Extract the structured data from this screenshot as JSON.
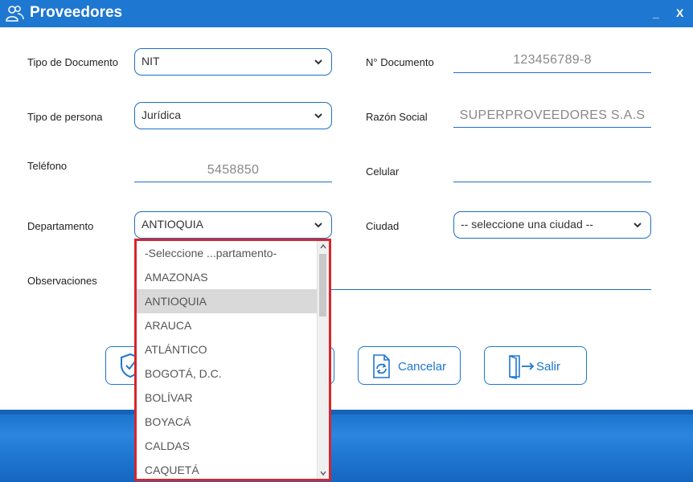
{
  "window": {
    "title": "Proveedores",
    "icon": "users-icon",
    "minimize_label": "_",
    "close_label": "X",
    "colors": {
      "titlebar": "#1e77d0",
      "accent": "#1e6fc0",
      "highlight": "#d7262c"
    }
  },
  "form": {
    "tipo_documento": {
      "label": "Tipo de Documento",
      "value": "NIT"
    },
    "numero_documento": {
      "label": "N° Documento",
      "value": "123456789-8"
    },
    "tipo_persona": {
      "label": "Tipo de persona",
      "value": "Jurídica"
    },
    "razon_social": {
      "label": "Razón Social",
      "value": "SUPERPROVEEDORES S.A.S"
    },
    "telefono": {
      "label": "Teléfono",
      "value": "5458850"
    },
    "celular": {
      "label": "Celular",
      "value": ""
    },
    "departamento": {
      "label": "Departamento",
      "value": "ANTIOQUIA"
    },
    "ciudad": {
      "label": "Ciudad",
      "value": "-- seleccione una ciudad --"
    },
    "observaciones": {
      "label": "Observaciones",
      "value": ""
    }
  },
  "buttons": {
    "guardar": {
      "icon": "shield-check-icon"
    },
    "cancelar": {
      "label": "Cancelar",
      "icon": "refresh-icon"
    },
    "salir": {
      "label": "Salir",
      "icon": "exit-door-icon"
    }
  },
  "departamento_dropdown": {
    "selected": "ANTIOQUIA",
    "options": [
      "-Seleccione ...partamento-",
      "AMAZONAS",
      "ANTIOQUIA",
      "ARAUCA",
      "ATLÁNTICO",
      "BOGOTÁ, D.C.",
      "BOLÍVAR",
      "BOYACÁ",
      "CALDAS",
      "CAQUETÁ"
    ]
  }
}
